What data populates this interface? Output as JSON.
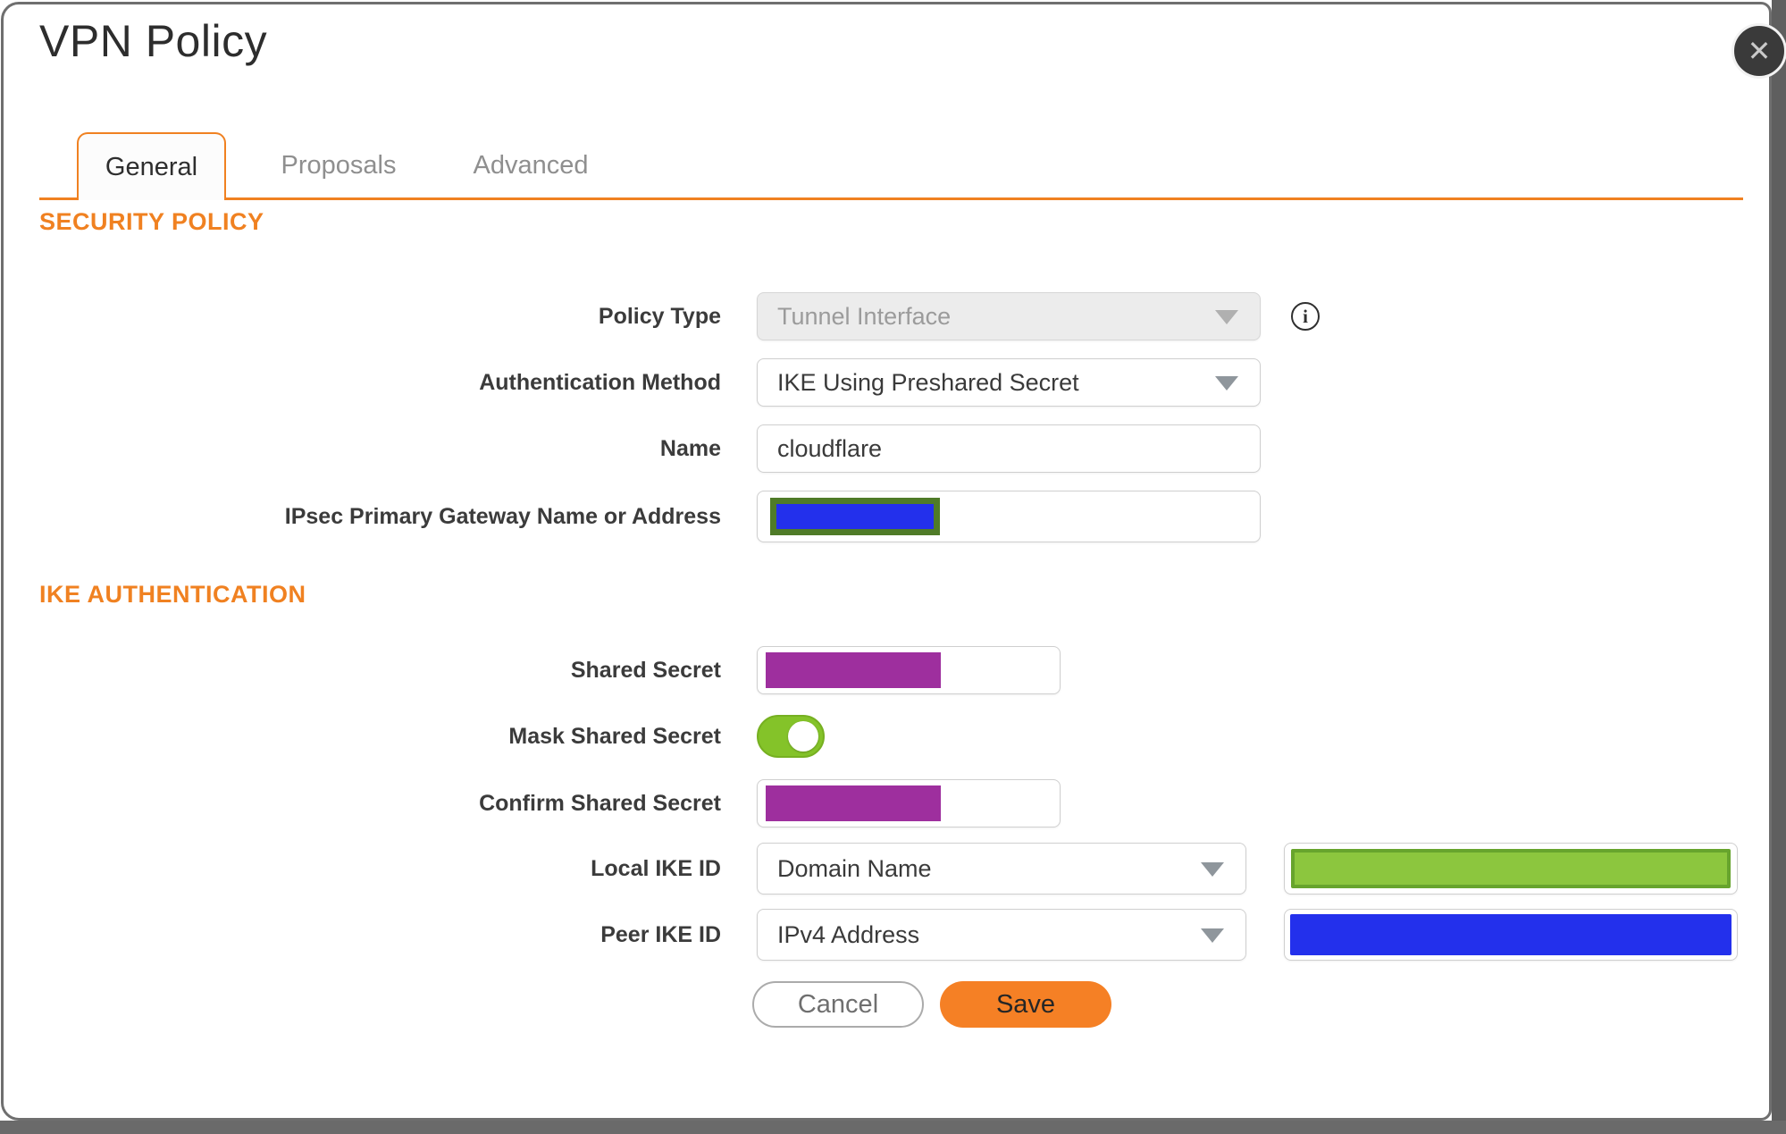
{
  "dialog": {
    "title": "VPN Policy",
    "close_glyph": "✕"
  },
  "tabs": [
    {
      "label": "General",
      "active": true
    },
    {
      "label": "Proposals",
      "active": false
    },
    {
      "label": "Advanced",
      "active": false
    }
  ],
  "sections": {
    "security_policy": "SECURITY POLICY",
    "ike_authentication": "IKE AUTHENTICATION"
  },
  "fields": {
    "policy_type": {
      "label": "Policy Type",
      "value": "Tunnel Interface",
      "disabled": true,
      "info_glyph": "i"
    },
    "auth_method": {
      "label": "Authentication Method",
      "value": "IKE Using Preshared Secret"
    },
    "name": {
      "label": "Name",
      "value": "cloudflare"
    },
    "gateway": {
      "label": "IPsec Primary Gateway Name or Address",
      "value": "",
      "redaction": "blue box with olive border"
    },
    "shared_secret": {
      "label": "Shared Secret",
      "value": "",
      "redaction": "purple box"
    },
    "mask_shared_secret": {
      "label": "Mask Shared Secret",
      "state": "on"
    },
    "confirm_shared_secret": {
      "label": "Confirm Shared Secret",
      "value": "",
      "redaction": "purple box"
    },
    "local_ike_id": {
      "label": "Local IKE ID",
      "value": "Domain Name",
      "id_redaction": "green box"
    },
    "peer_ike_id": {
      "label": "Peer IKE ID",
      "value": "IPv4 Address",
      "id_redaction": "blue box"
    }
  },
  "buttons": {
    "cancel": "Cancel",
    "save": "Save"
  },
  "colors": {
    "accent_orange": "#F08121",
    "save_orange": "#F58025",
    "redact_blue": "#2330EC",
    "redact_olive_border": "#4F7B28",
    "redact_purple": "#9E2F9E",
    "redact_green": "#8CC63E",
    "redact_green_border": "#67A42D",
    "toggle_green": "#84C329",
    "backdrop_gray": "#5F5F5F",
    "label_text": "#3B3B3B",
    "disabled_text": "#9B9B9B"
  }
}
